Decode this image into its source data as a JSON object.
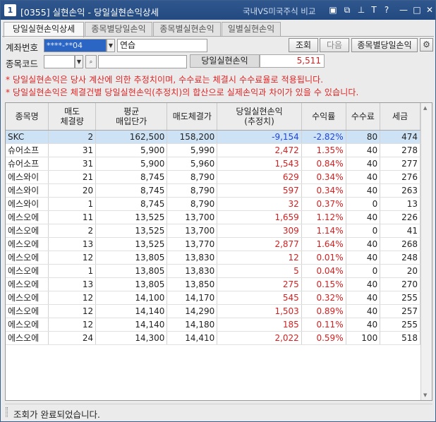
{
  "window": {
    "number_badge": "1",
    "title": "[0355] 실현손익 - 당일실현손익상세",
    "compare_link": "국내VS미국주식 비교",
    "icons": [
      "window-icon",
      "copy-icon",
      "pin-icon",
      "text-size-icon",
      "help-icon",
      "minimize-icon",
      "maximize-icon",
      "close-icon"
    ],
    "icon_glyphs": [
      "▣",
      "⧉",
      "⊥",
      "T",
      "?",
      "—",
      "□",
      "✕"
    ]
  },
  "tabs": [
    {
      "label": "당일실현손익상세",
      "active": true
    },
    {
      "label": "종목별당일손익",
      "active": false
    },
    {
      "label": "종목별실현손익",
      "active": false
    },
    {
      "label": "일별실현손익",
      "active": false
    }
  ],
  "form": {
    "account_label": "계좌번호",
    "account_value": "****-**04",
    "account_name": "연습",
    "query_button": "조회",
    "next_button": "다음",
    "by_stock_button": "종목별당일손익",
    "stock_code_label": "종목코드",
    "stock_code_value": "",
    "stock_name_value": "",
    "daily_pl_label": "당일실현손익",
    "daily_pl_value": "5,511"
  },
  "notes": [
    "* 당일실현손익은 당사 계산에 의한 추정치이며, 수수료는 체결시 수수료율로 적용됩니다.",
    "* 당일실현손익은 체결건별 당일실현손익(추정치)의 합산으로 실제손익과 차이가 있을 수 있습니다."
  ],
  "table": {
    "headers": [
      {
        "line1": "종목명",
        "line2": ""
      },
      {
        "line1": "매도",
        "line2": "체결량"
      },
      {
        "line1": "평균",
        "line2": "매입단가"
      },
      {
        "line1": "매도체결가",
        "line2": ""
      },
      {
        "line1": "당일실현손익",
        "line2": "(추정치)"
      },
      {
        "line1": "수익률",
        "line2": ""
      },
      {
        "line1": "수수료",
        "line2": ""
      },
      {
        "line1": "세금",
        "line2": ""
      }
    ],
    "rows": [
      {
        "name": "SKC",
        "qty": "2",
        "avg_price": "162,500",
        "sell_price": "158,200",
        "pl": "-9,154",
        "rate": "-2.82%",
        "fee": "80",
        "tax": "474",
        "selected": true
      },
      {
        "name": "슈어소프",
        "qty": "31",
        "avg_price": "5,900",
        "sell_price": "5,990",
        "pl": "2,472",
        "rate": "1.35%",
        "fee": "40",
        "tax": "278"
      },
      {
        "name": "슈어소프",
        "qty": "31",
        "avg_price": "5,900",
        "sell_price": "5,960",
        "pl": "1,543",
        "rate": "0.84%",
        "fee": "40",
        "tax": "277"
      },
      {
        "name": "에스와이",
        "qty": "21",
        "avg_price": "8,745",
        "sell_price": "8,790",
        "pl": "629",
        "rate": "0.34%",
        "fee": "40",
        "tax": "276"
      },
      {
        "name": "에스와이",
        "qty": "20",
        "avg_price": "8,745",
        "sell_price": "8,790",
        "pl": "597",
        "rate": "0.34%",
        "fee": "40",
        "tax": "263"
      },
      {
        "name": "에스와이",
        "qty": "1",
        "avg_price": "8,745",
        "sell_price": "8,790",
        "pl": "32",
        "rate": "0.37%",
        "fee": "0",
        "tax": "13"
      },
      {
        "name": "에스오에",
        "qty": "11",
        "avg_price": "13,525",
        "sell_price": "13,700",
        "pl": "1,659",
        "rate": "1.12%",
        "fee": "40",
        "tax": "226"
      },
      {
        "name": "에스오에",
        "qty": "2",
        "avg_price": "13,525",
        "sell_price": "13,700",
        "pl": "309",
        "rate": "1.14%",
        "fee": "0",
        "tax": "41"
      },
      {
        "name": "에스오에",
        "qty": "13",
        "avg_price": "13,525",
        "sell_price": "13,770",
        "pl": "2,877",
        "rate": "1.64%",
        "fee": "40",
        "tax": "268"
      },
      {
        "name": "에스오에",
        "qty": "12",
        "avg_price": "13,805",
        "sell_price": "13,830",
        "pl": "12",
        "rate": "0.01%",
        "fee": "40",
        "tax": "248"
      },
      {
        "name": "에스오에",
        "qty": "1",
        "avg_price": "13,805",
        "sell_price": "13,830",
        "pl": "5",
        "rate": "0.04%",
        "fee": "0",
        "tax": "20"
      },
      {
        "name": "에스오에",
        "qty": "13",
        "avg_price": "13,805",
        "sell_price": "13,850",
        "pl": "275",
        "rate": "0.15%",
        "fee": "40",
        "tax": "270"
      },
      {
        "name": "에스오에",
        "qty": "12",
        "avg_price": "14,100",
        "sell_price": "14,170",
        "pl": "545",
        "rate": "0.32%",
        "fee": "40",
        "tax": "255"
      },
      {
        "name": "에스오에",
        "qty": "12",
        "avg_price": "14,140",
        "sell_price": "14,290",
        "pl": "1,503",
        "rate": "0.89%",
        "fee": "40",
        "tax": "257"
      },
      {
        "name": "에스오에",
        "qty": "12",
        "avg_price": "14,140",
        "sell_price": "14,180",
        "pl": "185",
        "rate": "0.11%",
        "fee": "40",
        "tax": "255"
      },
      {
        "name": "에스오에",
        "qty": "24",
        "avg_price": "14,300",
        "sell_price": "14,410",
        "pl": "2,022",
        "rate": "0.59%",
        "fee": "100",
        "tax": "518"
      }
    ]
  },
  "status": {
    "message": "조회가 완료되었습니다."
  },
  "colors": {
    "title_bar": "#234a80",
    "profit": "#d42020",
    "loss": "#1f44d8",
    "selected_row": "#cde3f5",
    "note_text": "#e02424"
  }
}
